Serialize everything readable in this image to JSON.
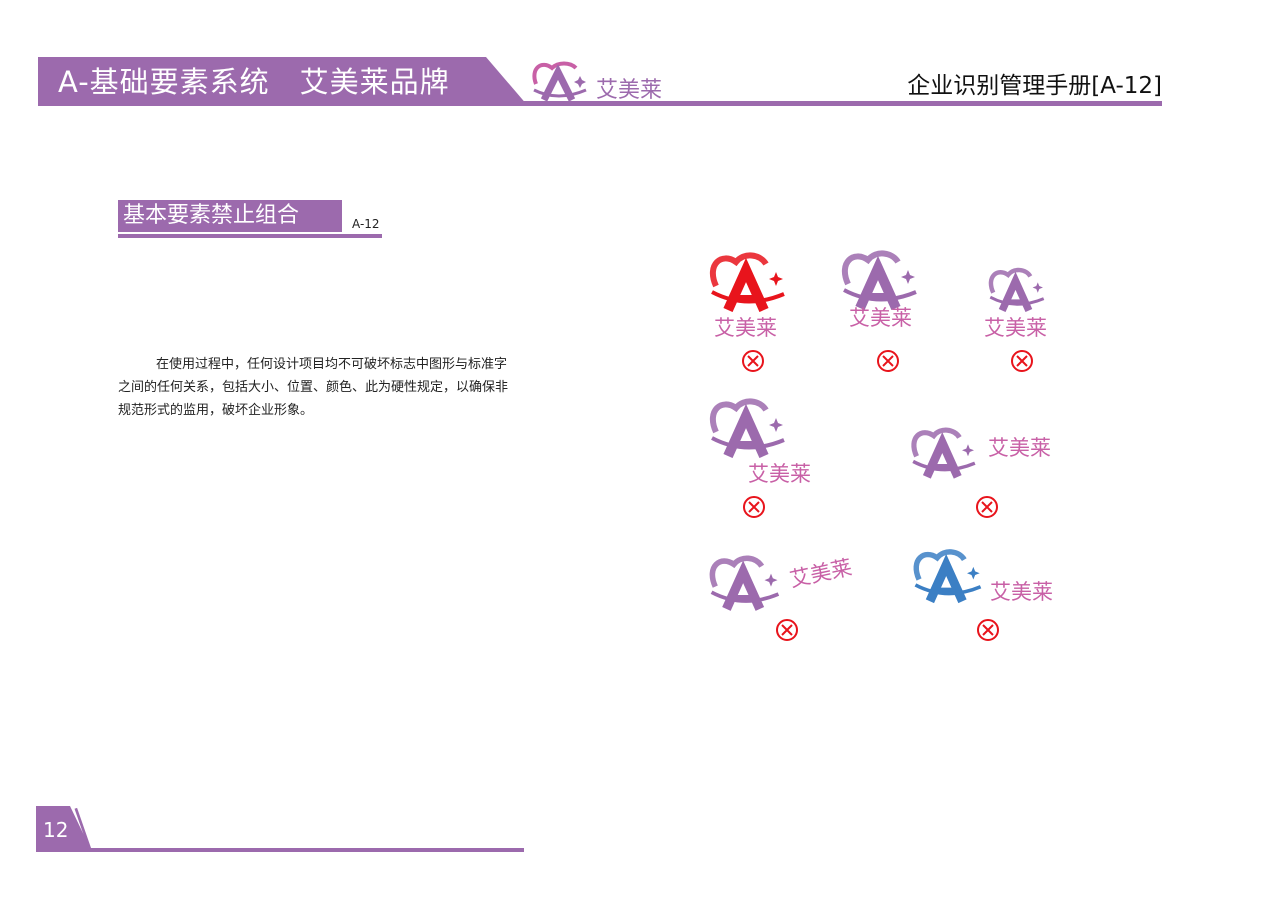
{
  "header": {
    "left_title": "A-基础要素系统　艾美莱品牌",
    "logo_text": "艾美莱",
    "right_title": "企业识别管理手册[A-12]"
  },
  "section": {
    "title": "基本要素禁止组合",
    "code": "A-12"
  },
  "body": {
    "paragraph": "在使用过程中，任何设计项目均不可破坏标志中图形与标准字之间的任何关系，包括大小、位置、颜色、此为硬性规定，以确保非规范形式的监用，破坏企业形象。"
  },
  "examples": [
    {
      "text": "艾美莱",
      "logo_color": "#e8141c",
      "text_color": "#c860a6"
    },
    {
      "text": "艾美莱",
      "logo_color": "#9c6aad",
      "text_color": "#c860a6"
    },
    {
      "text": "艾美莱",
      "logo_color": "#9c6aad",
      "text_color": "#c860a6"
    },
    {
      "text": "艾美莱",
      "logo_color": "#9c6aad",
      "text_color": "#c860a6"
    },
    {
      "text": "艾美莱",
      "logo_color": "#9c6aad",
      "text_color": "#c860a6"
    },
    {
      "text": "艾美莱",
      "logo_color": "#9c6aad",
      "text_color": "#c860a6"
    },
    {
      "text": "艾美莱",
      "logo_color": "#3b7fc4",
      "text_color": "#c860a6"
    }
  ],
  "colors": {
    "brand_purple": "#9c6aad",
    "brand_pink": "#c860a6",
    "forbidden_red": "#e8141c"
  },
  "icons": {
    "forbidden": "circle-x-icon",
    "logo": "heart-a-logo"
  },
  "footer": {
    "page_number": "12"
  }
}
